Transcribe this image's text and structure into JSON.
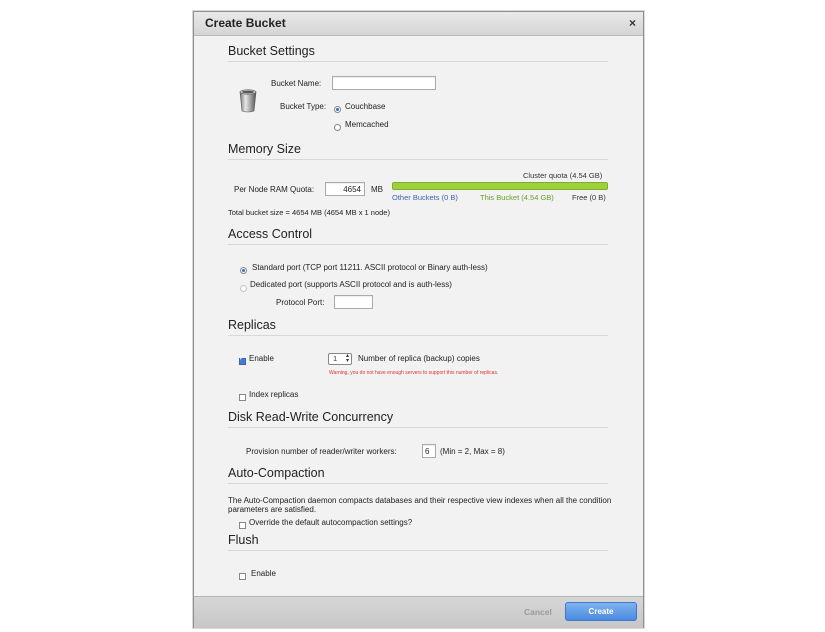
{
  "dialog": {
    "title": "Create Bucket",
    "close_icon": "×"
  },
  "bucket_settings": {
    "heading": "Bucket Settings",
    "name_label": "Bucket Name:",
    "name_value": "",
    "type_label": "Bucket Type:",
    "type_options": [
      "Couchbase",
      "Memcached"
    ],
    "selected_type": "Couchbase",
    "icon": "bucket-icon"
  },
  "memory": {
    "heading": "Memory Size",
    "quota_label": "Per Node RAM Quota:",
    "quota_value": "4654",
    "unit": "MB",
    "cluster_quota": "Cluster quota (4.54 GB)",
    "other_buckets": "Other Buckets (0 B)",
    "this_bucket": "This Bucket (4.54 GB)",
    "free": "Free (0 B)",
    "this_bucket_fraction": 1.0,
    "total": "Total bucket size = 4654 MB (4654 MB x 1 node)"
  },
  "access": {
    "heading": "Access Control",
    "standard_port": "Standard port (TCP port 11211. ASCII protocol or Binary auth-less)",
    "dedicated_port": "Dedicated port (supports ASCII protocol and is auth-less)",
    "protocol_port_label": "Protocol Port:",
    "protocol_port_value": "",
    "selected": "standard"
  },
  "replicas": {
    "heading": "Replicas",
    "enable_label": "Enable",
    "enabled": true,
    "count_value": "1",
    "count_label": "Number of replica (backup) copies",
    "warning": "Warning, you do not have enough servers to support this number of replicas.",
    "index_label": "Index replicas",
    "index_checked": false
  },
  "disk": {
    "heading": "Disk Read-Write Concurrency",
    "workers_label": "Provision number of reader/writer workers:",
    "workers_value": "6",
    "workers_range": "(Min = 2, Max = 8)"
  },
  "autocompaction": {
    "heading": "Auto-Compaction",
    "description": "The Auto-Compaction daemon compacts databases and their respective view indexes when all the condition parameters are satisfied.",
    "override_label": "Override the default autocompaction settings?",
    "override_checked": false
  },
  "flush": {
    "heading": "Flush",
    "enable_label": "Enable",
    "enabled": false
  },
  "footer": {
    "cancel": "Cancel",
    "create": "Create"
  },
  "colors": {
    "accent": "#4b8ae0",
    "quota_bar": "#9dd03b",
    "other_buckets_text": "#3a64b0",
    "this_bucket_text": "#6a9d22",
    "warning": "#d33333"
  }
}
